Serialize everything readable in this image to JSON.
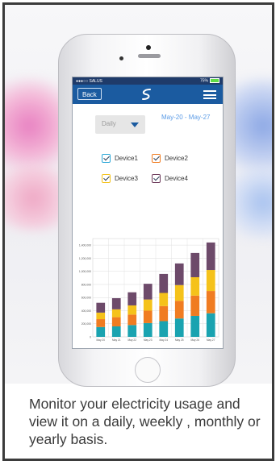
{
  "status": {
    "carrier": "●●●○○ SALUS",
    "battery": "75%"
  },
  "navbar": {
    "back_label": "Back",
    "logo_glyph": "S"
  },
  "filter": {
    "period": "Daily",
    "date_range": "May-20 - May-27"
  },
  "devices": [
    {
      "label": "Device1",
      "color": "#2aa7d8"
    },
    {
      "label": "Device2",
      "color": "#f07c21"
    },
    {
      "label": "Device3",
      "color": "#f5c21a"
    },
    {
      "label": "Device4",
      "color": "#6d3a5a"
    }
  ],
  "chart_data": {
    "type": "bar",
    "stacked": true,
    "categories": [
      "May 20",
      "May 21",
      "May 22",
      "May 23",
      "May 24",
      "May 25",
      "May 26",
      "May 27"
    ],
    "ytick_labels": [
      "0",
      "200,000",
      "400,000",
      "600,000",
      "800,000",
      "1,000,000",
      "1,200,000",
      "1,400,000"
    ],
    "ylim": [
      0,
      1500000
    ],
    "grid": true,
    "series": [
      {
        "name": "Device1",
        "color": "#1aa3b0",
        "values": [
          150000,
          160000,
          180000,
          210000,
          240000,
          280000,
          320000,
          360000
        ]
      },
      {
        "name": "Device2",
        "color": "#f07c21",
        "values": [
          120000,
          140000,
          160000,
          190000,
          230000,
          270000,
          310000,
          340000
        ]
      },
      {
        "name": "Device3",
        "color": "#f5c21a",
        "values": [
          100000,
          120000,
          140000,
          170000,
          200000,
          240000,
          280000,
          320000
        ]
      },
      {
        "name": "Device4",
        "color": "#6d4a6a",
        "values": [
          150000,
          170000,
          200000,
          240000,
          290000,
          330000,
          370000,
          420000
        ]
      }
    ]
  },
  "caption": "Monitor your electricity usage and view it on a daily, weekly , monthly or yearly basis."
}
